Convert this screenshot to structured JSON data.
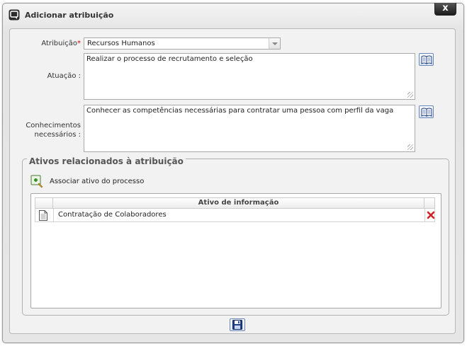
{
  "window": {
    "title": "Adicionar atribuição",
    "close_label": "x"
  },
  "form": {
    "atribuicao_label": "Atribuição",
    "required_mark": "*",
    "atribuicao_value": "Recursos Humanos",
    "atuacao_label": "Atuação :",
    "atuacao_value": "Realizar o processo de recrutamento e seleção",
    "conhecimentos_label_line1": "Conhecimentos",
    "conhecimentos_label_line2": "necessários :",
    "conhecimentos_value": "Conhecer as competências necessárias para contratar uma pessoa com perfil da vaga"
  },
  "assets": {
    "legend": "Ativos relacionados à atribuição",
    "associate_label": "Associar ativo do processo",
    "grid": {
      "column_header": "Ativo de informação",
      "rows": [
        {
          "name": "Contratação de Colaboradores"
        }
      ]
    }
  },
  "icons": {
    "title": "app-window-icon",
    "book": "book-icon",
    "add": "add-asset-icon",
    "document": "document-icon",
    "delete": "delete-x-icon",
    "save": "floppy-save-icon"
  },
  "colors": {
    "required": "#d40000",
    "delete": "#d42020",
    "button_border": "#6b86b8"
  }
}
